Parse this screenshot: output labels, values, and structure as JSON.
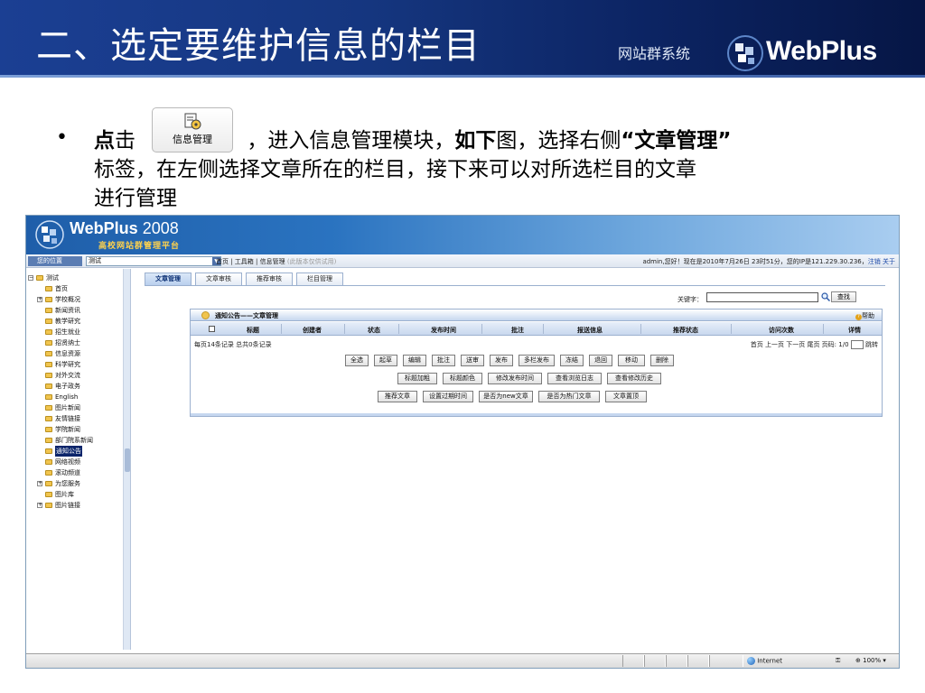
{
  "slide": {
    "title": "二、选定要维护信息的栏目",
    "brand_sub": "网站群系统",
    "brand_name": "WebPlus"
  },
  "bullet": {
    "line1_a": "点",
    "line1_b": "击",
    "button_label": "信息管理",
    "line1_c": "，进入信息管理模块，",
    "line1_d": "如下",
    "line1_e": "图，选择右侧",
    "line1_f": "“文章管理”",
    "line2": "标签，在左侧选择文章所在的栏目，接下来可以对所选栏目的文章",
    "line3": "进行管理"
  },
  "app": {
    "title": "WebPlus",
    "year": " 2008",
    "subtitle": "高校网站群管理平台",
    "location_label": "您的位置",
    "location_value": "测试",
    "breadcrumb": "首页 | 工具箱 | 信息管理",
    "breadcrumb_note": "(此版本仅供试用)",
    "user_info": "admin,您好！现在是2010年7月26日 23时51分，您的IP是121.229.30.236，",
    "logout": "注销",
    "about": "关于"
  },
  "tree": [
    {
      "label": "测试",
      "level": 0,
      "toggle": "−"
    },
    {
      "label": "首页",
      "level": 1,
      "toggle": ""
    },
    {
      "label": "学校概况",
      "level": 1,
      "toggle": "+"
    },
    {
      "label": "新闻资讯",
      "level": 1,
      "toggle": ""
    },
    {
      "label": "教学研究",
      "level": 1,
      "toggle": ""
    },
    {
      "label": "招生就业",
      "level": 1,
      "toggle": ""
    },
    {
      "label": "招贤纳士",
      "level": 1,
      "toggle": ""
    },
    {
      "label": "信息资源",
      "level": 1,
      "toggle": ""
    },
    {
      "label": "科学研究",
      "level": 1,
      "toggle": ""
    },
    {
      "label": "对外交流",
      "level": 1,
      "toggle": ""
    },
    {
      "label": "电子政务",
      "level": 1,
      "toggle": ""
    },
    {
      "label": "English",
      "level": 1,
      "toggle": ""
    },
    {
      "label": "图片新闻",
      "level": 1,
      "toggle": ""
    },
    {
      "label": "友情链接",
      "level": 1,
      "toggle": ""
    },
    {
      "label": "学院新闻",
      "level": 1,
      "toggle": ""
    },
    {
      "label": "部门院系新闻",
      "level": 1,
      "toggle": ""
    },
    {
      "label": "通知公告",
      "level": 1,
      "toggle": "",
      "selected": true
    },
    {
      "label": "网络视频",
      "level": 1,
      "toggle": ""
    },
    {
      "label": "滚动频道",
      "level": 1,
      "toggle": ""
    },
    {
      "label": "为您服务",
      "level": 1,
      "toggle": "+"
    },
    {
      "label": "图片库",
      "level": 1,
      "toggle": ""
    },
    {
      "label": "图片链接",
      "level": 1,
      "toggle": "+"
    }
  ],
  "tabs": [
    "文章管理",
    "文章审核",
    "推荐审核",
    "栏目管理"
  ],
  "search": {
    "label": "关键字：",
    "button": "查找"
  },
  "panel": {
    "title": "通知公告——文章管理",
    "help": "帮助",
    "columns": [
      "标题",
      "创建者",
      "状态",
      "发布时间",
      "批注",
      "报送信息",
      "推荐状态",
      "访问次数",
      "详情"
    ],
    "pager_left": "每页14条记录 总共0条记录",
    "pager_right": "首页  上一页  下一页  尾页  页码: 1/0",
    "jump": "跳转",
    "row1": [
      "全选",
      "起草",
      "编辑",
      "批注",
      "送审",
      "发布",
      "多栏发布",
      "冻结",
      "退回",
      "移动",
      "删除"
    ],
    "row2": [
      "标题加粗",
      "标题颜色",
      "修改发布时间",
      "查看浏览日志",
      "查看修改历史"
    ],
    "row3": [
      "推荐文章",
      "设置过期时间",
      "是否为new文章",
      "是否为热门文章",
      "文章置顶"
    ]
  },
  "status": {
    "zone": "Internet",
    "zoom": "100%"
  }
}
